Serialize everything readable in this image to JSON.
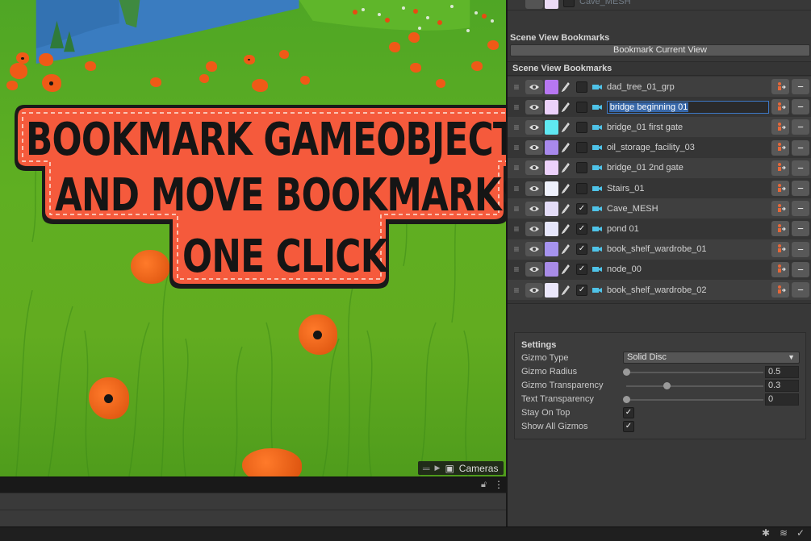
{
  "scene": {
    "title_lines": [
      "BOOKMARK GAMEOBJECTS",
      "AND MOVE BOOKMARKS",
      "ONE CLICK"
    ],
    "camera_overlay_label": "Cameras",
    "colors": {
      "grass": "#5faf22",
      "poppy": "#ef5a17",
      "title_bg": "#f55a3c",
      "sky": "#3a7cc0"
    }
  },
  "top_row": {
    "label": "Cave_MESH"
  },
  "scene_view_bookmarks": {
    "header": "Scene View Bookmarks",
    "bookmark_button": "Bookmark Current View"
  },
  "bookmark_list": {
    "header": "Scene View Bookmarks",
    "items": [
      {
        "label": "dad_tree_01_grp",
        "color": "#b777f2",
        "checked": false,
        "editing": false
      },
      {
        "label": "bridge beginning 01",
        "color": "#ecd1fb",
        "checked": false,
        "editing": true
      },
      {
        "label": "bridge_01 first gate",
        "color": "#5fe9f2",
        "checked": false,
        "editing": false
      },
      {
        "label": "oil_storage_facility_03",
        "color": "#a889ec",
        "checked": false,
        "editing": false
      },
      {
        "label": "bridge_01 2nd  gate",
        "color": "#ecd1fb",
        "checked": false,
        "editing": false
      },
      {
        "label": "Stairs_01",
        "color": "#eef0fb",
        "checked": false,
        "editing": false
      },
      {
        "label": "Cave_MESH",
        "color": "#e3dcf7",
        "checked": true,
        "editing": false
      },
      {
        "label": "pond 01",
        "color": "#e6e6fb",
        "checked": true,
        "editing": false
      },
      {
        "label": "book_shelf_wardrobe_01",
        "color": "#a693ef",
        "checked": true,
        "editing": false
      },
      {
        "label": "node_00",
        "color": "#a88be7",
        "checked": true,
        "editing": false
      },
      {
        "label": "book_shelf_wardrobe_02",
        "color": "#ebe7fb",
        "checked": true,
        "editing": false
      }
    ]
  },
  "settings": {
    "header": "Settings",
    "gizmo_type": {
      "label": "Gizmo Type",
      "value": "Solid Disc"
    },
    "gizmo_radius": {
      "label": "Gizmo Radius",
      "value": "0.5",
      "fraction": 0.0
    },
    "gizmo_transparency": {
      "label": "Gizmo Transparency",
      "value": "0.3",
      "fraction": 0.3
    },
    "text_transparency": {
      "label": "Text Transparency",
      "value": "0",
      "fraction": 0.0
    },
    "stay_on_top": {
      "label": "Stay On Top",
      "checked": true
    },
    "show_all_gizmos": {
      "label": "Show All Gizmos",
      "checked": true
    }
  }
}
